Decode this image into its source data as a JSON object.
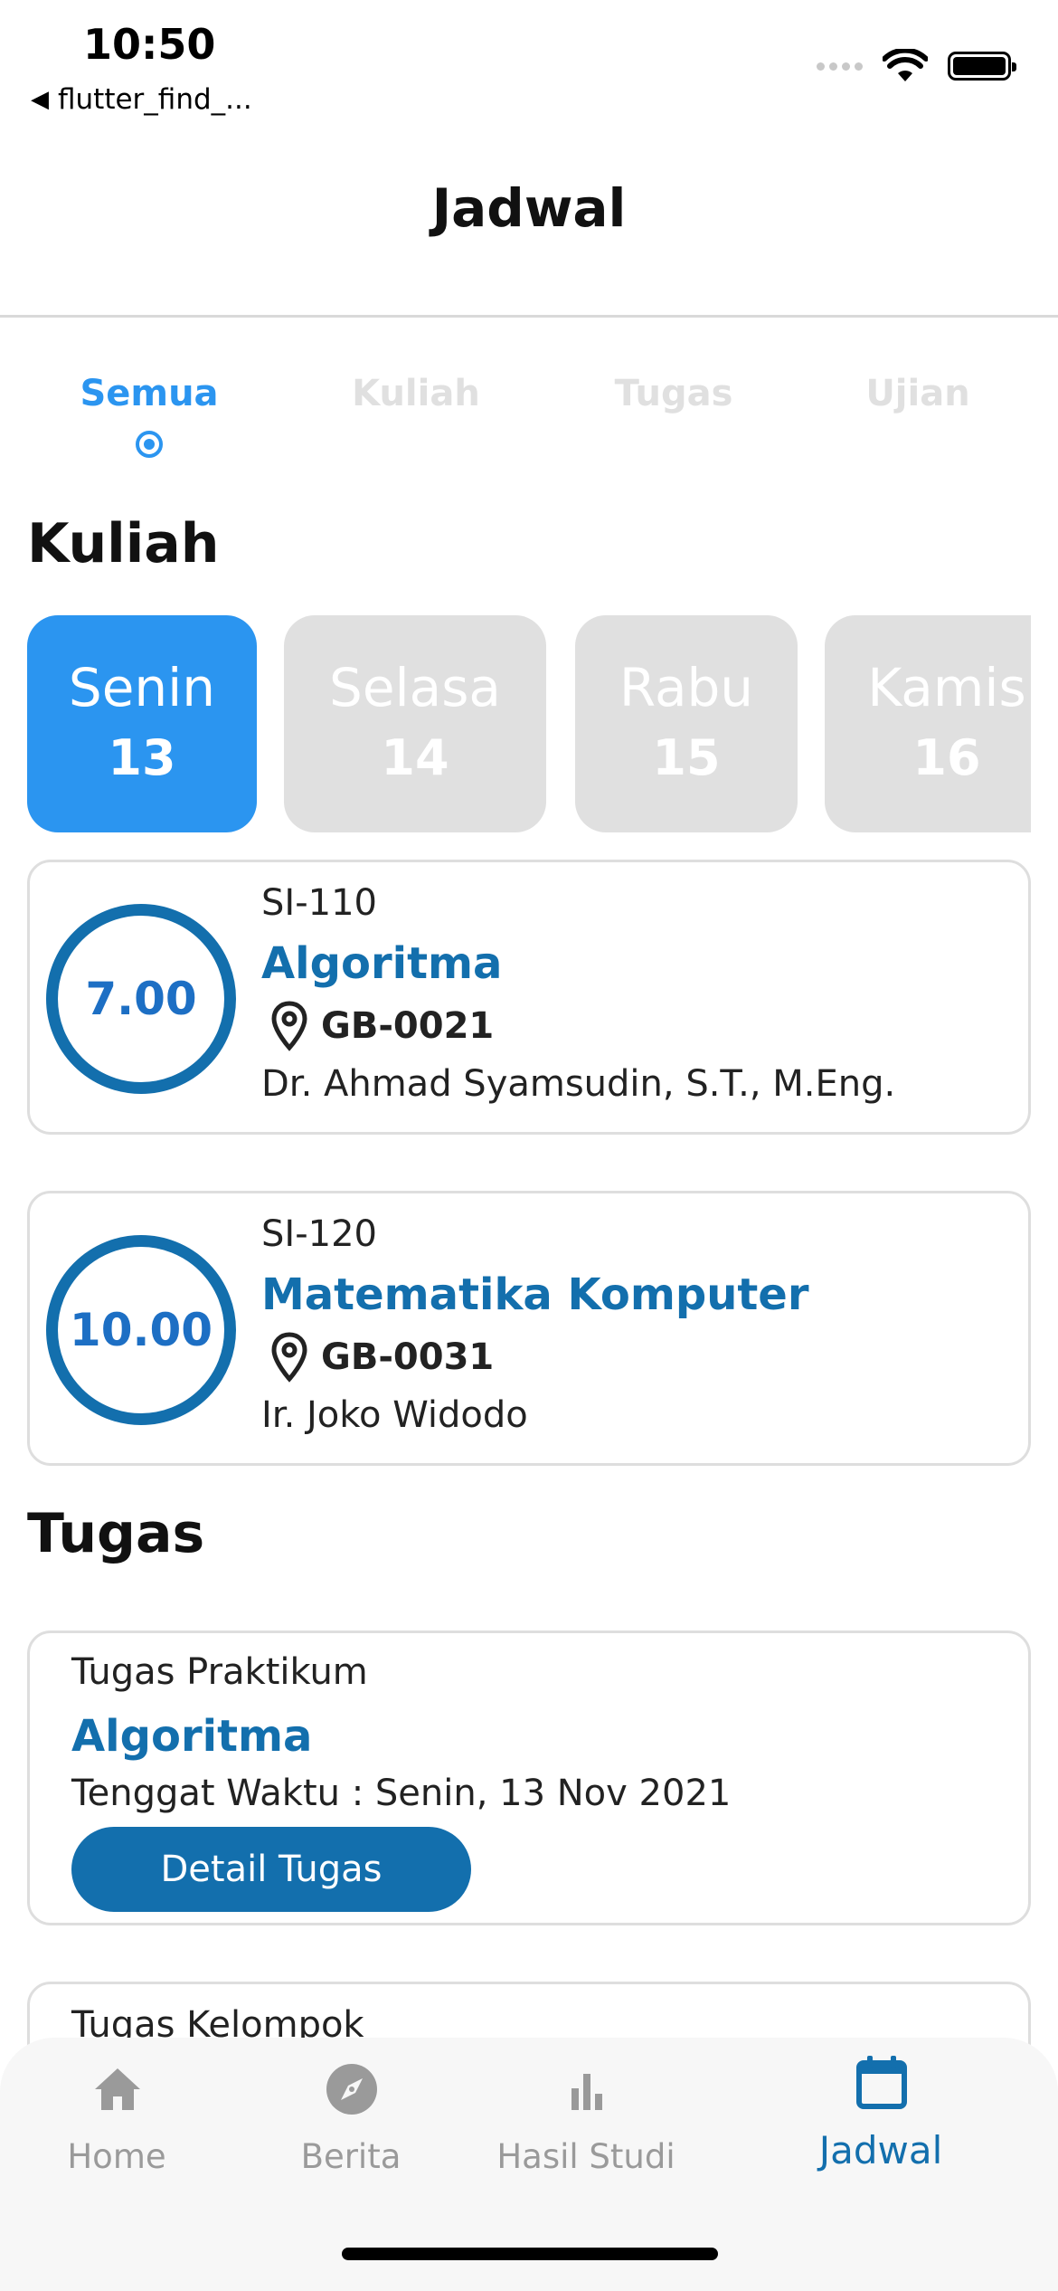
{
  "status_bar": {
    "time": "10:50",
    "back_label": "flutter_find_..."
  },
  "appbar": {
    "title": "Jadwal"
  },
  "filter_tabs": [
    {
      "label": "Semua",
      "active": true
    },
    {
      "label": "Kuliah",
      "active": false
    },
    {
      "label": "Tugas",
      "active": false
    },
    {
      "label": "Ujian",
      "active": false
    }
  ],
  "kuliah_section": {
    "title": "Kuliah",
    "days": [
      {
        "name": "Senin",
        "date": "13",
        "active": true
      },
      {
        "name": "Selasa",
        "date": "14",
        "active": false
      },
      {
        "name": "Rabu",
        "date": "15",
        "active": false
      },
      {
        "name": "Kamis",
        "date": "16",
        "active": false
      }
    ],
    "classes": [
      {
        "time": "7.00",
        "code": "SI-110",
        "name": "Algoritma",
        "room": "GB-0021",
        "lecturer": "Dr. Ahmad Syamsudin, S.T., M.Eng."
      },
      {
        "time": "10.00",
        "code": "SI-120",
        "name": "Matematika Komputer",
        "room": "GB-0031",
        "lecturer": "Ir. Joko Widodo"
      }
    ]
  },
  "tugas_section": {
    "title": "Tugas",
    "tasks": [
      {
        "type": "Tugas Praktikum",
        "course": "Algoritma",
        "deadline": "Tenggat Waktu : Senin, 13 Nov 2021",
        "button_label": "Detail Tugas"
      },
      {
        "type": "Tugas Kelompok"
      }
    ]
  },
  "bottom_nav": [
    {
      "label": "Home",
      "icon": "home-icon",
      "active": false
    },
    {
      "label": "Berita",
      "icon": "compass-icon",
      "active": false
    },
    {
      "label": "Hasil Studi",
      "icon": "bar-chart-icon",
      "active": false
    },
    {
      "label": "Jadwal",
      "icon": "calendar-icon",
      "active": true
    }
  ],
  "colors": {
    "accent": "#2b95f0",
    "primary_dark": "#136fad",
    "inactive_chip": "#e0e0e0",
    "nav_inactive": "#9a9a9a"
  }
}
